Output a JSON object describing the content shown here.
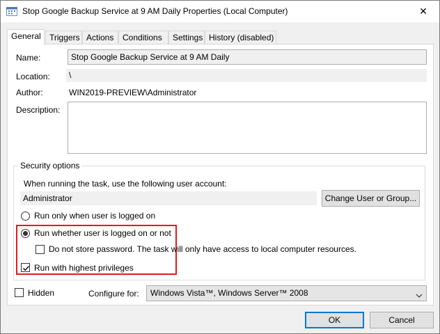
{
  "window": {
    "title": "Stop Google Backup Service at 9 AM Daily Properties (Local Computer)",
    "close_glyph": "✕"
  },
  "tabs": [
    {
      "label": "General",
      "active": true
    },
    {
      "label": "Triggers"
    },
    {
      "label": "Actions"
    },
    {
      "label": "Conditions"
    },
    {
      "label": "Settings"
    },
    {
      "label": "History (disabled)"
    }
  ],
  "general": {
    "name_label": "Name:",
    "name_value": "Stop Google Backup Service at 9 AM Daily",
    "location_label": "Location:",
    "location_value": "\\",
    "author_label": "Author:",
    "author_value": "WIN2019-PREVIEW\\Administrator",
    "description_label": "Description:",
    "description_value": ""
  },
  "security": {
    "group_title": "Security options",
    "account_prompt": "When running the task, use the following user account:",
    "account_value": "Administrator",
    "change_button": "Change User or Group...",
    "radio_logged_on": "Run only when user is logged on",
    "radio_whether": "Run whether user is logged on or not",
    "checkbox_no_store": "Do not store password.  The task will only have access to local computer resources.",
    "checkbox_highest": "Run with highest privileges",
    "selected_radio": "whether",
    "no_store_checked": false,
    "highest_checked": true
  },
  "bottom": {
    "hidden_label": "Hidden",
    "hidden_checked": false,
    "configure_label": "Configure for:",
    "configure_value": "Windows Vista™, Windows Server™ 2008"
  },
  "buttons": {
    "ok": "OK",
    "cancel": "Cancel"
  },
  "colors": {
    "highlight": "#e21b1b",
    "default_button_border": "#0078d7"
  },
  "icons": {
    "title": "task-scheduler-icon",
    "close": "close-icon",
    "combo": "chevron-down-icon"
  }
}
